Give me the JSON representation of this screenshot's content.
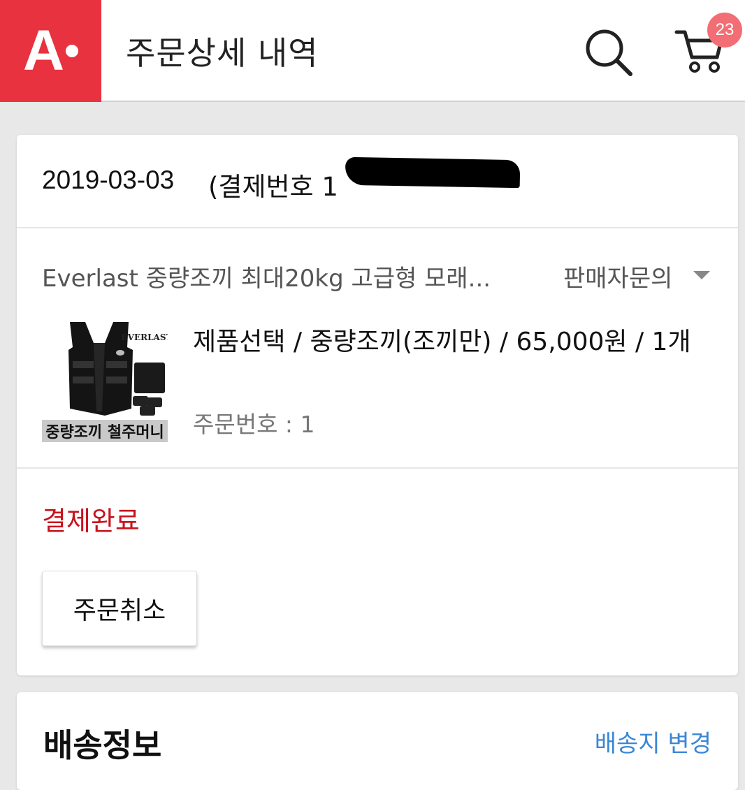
{
  "header": {
    "logo_text": "A",
    "title": "주문상세 내역",
    "search_icon": "search-icon",
    "cart_icon": "cart-icon",
    "cart_count": "23"
  },
  "order": {
    "date": "2019-03-03",
    "payment_label": "(결제번호 1",
    "product_name": "Everlast 중량조끼 최대20kg 고급형 모래...",
    "seller_inquiry": "판매자문의",
    "thumbnail_brand": "EVERLAST",
    "thumbnail_caption": "중량조끼 철주머니",
    "option_text": "제품선택 / 중량조끼(조끼만) / 65,000원 / 1개",
    "order_number": "주문번호 : 1",
    "status": "결제완료",
    "cancel_button": "주문취소"
  },
  "shipping": {
    "title": "배송정보",
    "change_link": "배송지 변경"
  },
  "colors": {
    "brand": "#e8323f",
    "status": "#c8131d",
    "link": "#3a86d6",
    "badge": "#f26d74"
  }
}
